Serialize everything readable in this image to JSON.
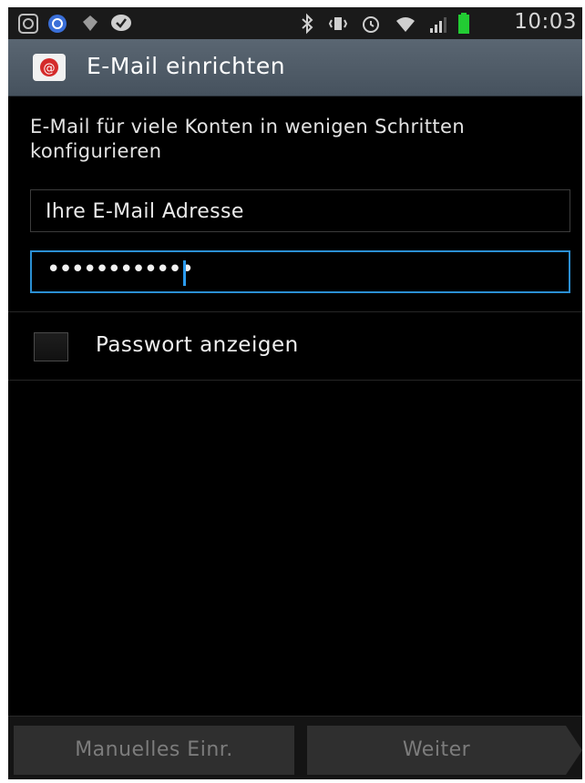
{
  "status_bar": {
    "left_icons": [
      "android-notification-icon",
      "sync-app-icon",
      "puzzle-app-icon",
      "chat-check-icon"
    ],
    "right_icons": [
      "bluetooth-icon",
      "vibrate-icon",
      "alarm-icon",
      "wifi-icon",
      "signal-icon",
      "battery-icon"
    ],
    "time": "10:03",
    "battery_color": "#22cc33"
  },
  "action_bar": {
    "title": "E-Mail einrichten",
    "icon": "email-app-icon"
  },
  "form": {
    "description": "E-Mail für viele Konten in wenigen Schritten konfigurieren",
    "email_value": "Ihre E-Mail Adresse",
    "password_value": "••••••••••••",
    "show_password_label": "Passwort anzeigen",
    "show_password_checked": false
  },
  "buttons": {
    "manual_label": "Manuelles Einr.",
    "next_label": "Weiter"
  },
  "colors": {
    "focus_accent": "#2b8fd3",
    "action_bar": "#4e5a66"
  }
}
